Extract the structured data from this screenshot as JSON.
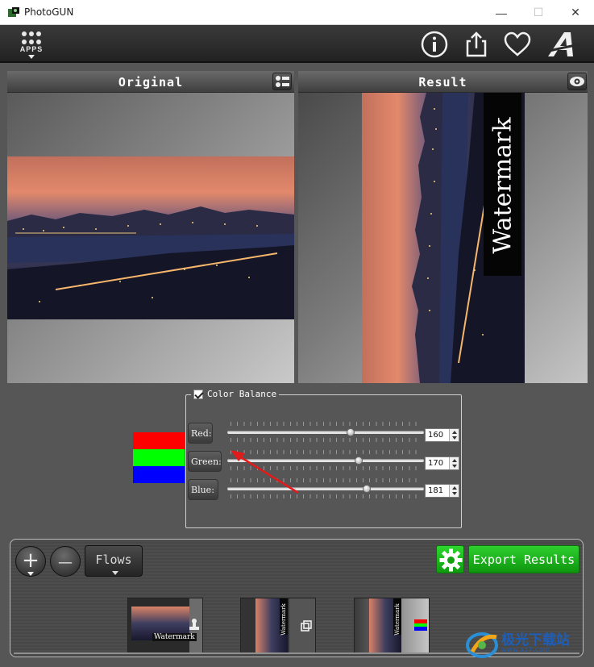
{
  "window": {
    "title": "PhotoGUN",
    "minimize": "—",
    "maximize": "☐",
    "close": "✕"
  },
  "toolbar": {
    "apps_label": "APPS",
    "icons": [
      "info-icon",
      "share-icon",
      "heart-icon",
      "font-a-icon"
    ]
  },
  "panels": {
    "original_title": "Original",
    "result_title": "Result",
    "result_watermark": "Watermark"
  },
  "color_balance": {
    "title": "Color Balance",
    "checked": true,
    "swatches": [
      "#ff0000",
      "#00ff00",
      "#0000ff"
    ],
    "channels": [
      {
        "label": "Red:",
        "value": "160",
        "fraction": 0.627
      },
      {
        "label": "Green:",
        "value": "170",
        "fraction": 0.667
      },
      {
        "label": "Blue:",
        "value": "181",
        "fraction": 0.71
      }
    ]
  },
  "flow": {
    "add": "+",
    "remove": "—",
    "flows_label": "Flows",
    "export_label": "Export Results",
    "thumbnails": [
      {
        "caption": "Watermark",
        "badge": "stamp-icon"
      },
      {
        "caption": "Watermark",
        "badge": "crop-icon"
      },
      {
        "caption": "Watermark",
        "badge": "color-balance-icon"
      }
    ]
  },
  "site_logo": {
    "name": "极光下载站",
    "url_text": "www.xz7.com"
  },
  "colors": {
    "accent_green": "#13b013",
    "annotation_arrow": "#e01b1b"
  }
}
